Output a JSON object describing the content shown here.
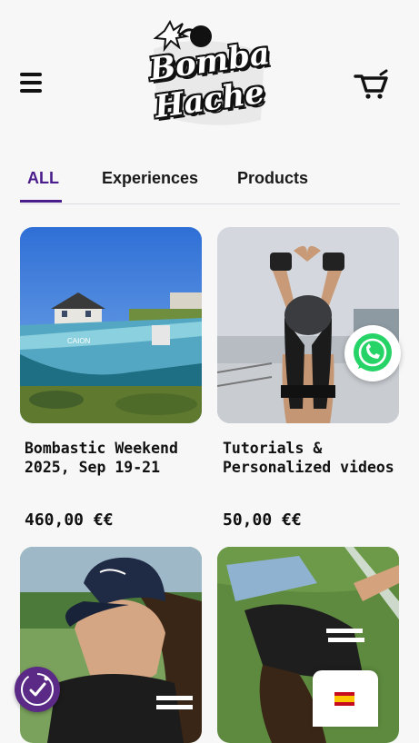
{
  "brand": {
    "logo_line1": "Bomba",
    "logo_line2": "Hache"
  },
  "tabs": [
    {
      "label": "ALL",
      "active": true
    },
    {
      "label": "Experiences",
      "active": false
    },
    {
      "label": "Products",
      "active": false
    }
  ],
  "products": [
    {
      "title": "Bombastic Weekend 2025, Sep 19-21",
      "price": "460,00 €€"
    },
    {
      "title": "Tutorials & Personalized videos",
      "price": "50,00 €€"
    },
    {
      "title": "",
      "price": ""
    },
    {
      "title": "",
      "price": ""
    }
  ],
  "colors": {
    "accent": "#4b1d8c",
    "whatsapp": "#25d366",
    "accessibility": "#5b2a86"
  },
  "icons": {
    "menu": "hamburger-icon",
    "cart": "cart-icon",
    "whatsapp": "whatsapp-icon",
    "accessibility": "accessibility-icon",
    "language": "spain-flag-icon"
  }
}
